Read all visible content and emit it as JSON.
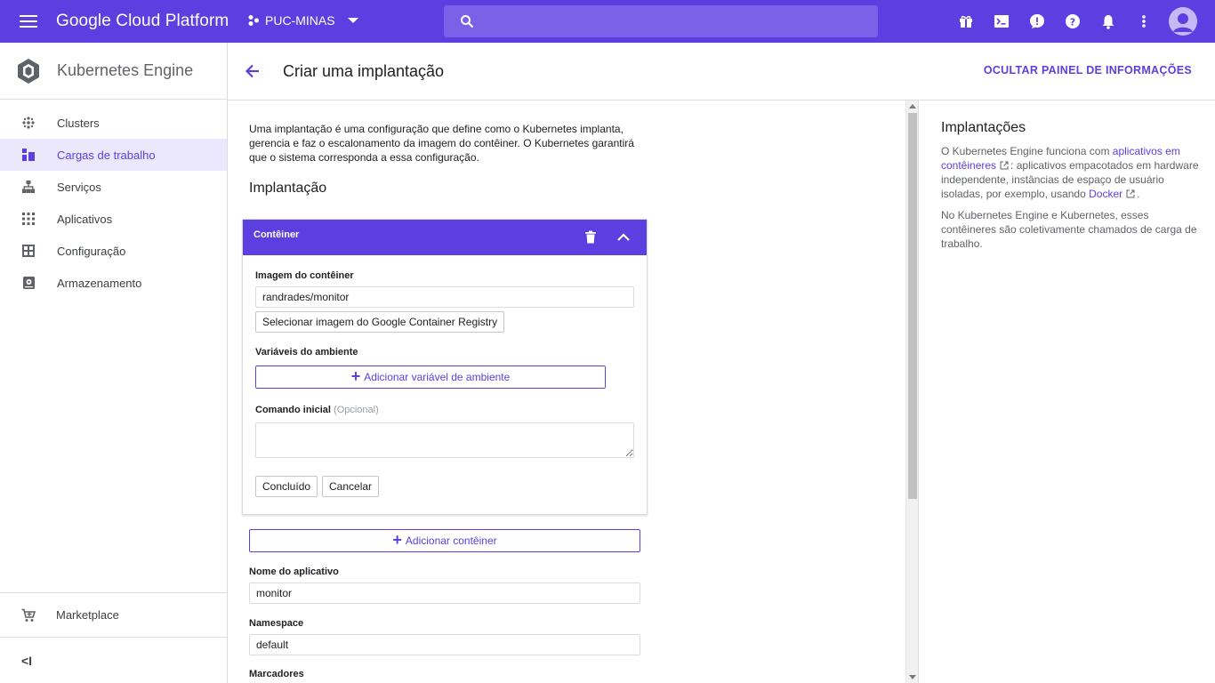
{
  "topbar": {
    "brand": "Google Cloud Platform",
    "project": "PUC-MINAS",
    "search_placeholder": "",
    "icons": [
      "gift-icon",
      "terminal-icon",
      "feedback-icon",
      "help-icon",
      "notifications-icon",
      "more-vert-icon"
    ]
  },
  "sidebar": {
    "product": "Kubernetes Engine",
    "items": [
      {
        "label": "Clusters",
        "icon": "clusters-icon"
      },
      {
        "label": "Cargas de trabalho",
        "icon": "workloads-icon",
        "active": true
      },
      {
        "label": "Serviços",
        "icon": "services-icon"
      },
      {
        "label": "Aplicativos",
        "icon": "apps-icon"
      },
      {
        "label": "Configuração",
        "icon": "config-icon"
      },
      {
        "label": "Armazenamento",
        "icon": "storage-icon"
      }
    ],
    "marketplace": "Marketplace",
    "collapse": "<I"
  },
  "header": {
    "title": "Criar uma implantação",
    "hide_panel": "OCULTAR PAINEL DE INFORMAÇÕES"
  },
  "main": {
    "description": "Uma implantação é uma configuração que define como o Kubernetes implanta, gerencia e faz o escalonamento da imagem do contêiner. O Kubernetes garantirá que o sistema corresponda a essa configuração.",
    "section_title": "Implantação",
    "container_card": {
      "title": "Contêiner",
      "image_label": "Imagem do contêiner",
      "image_value": "randrades/monitor",
      "select_image_button": "Selecionar imagem do Google Container Registry",
      "env_label": "Variáveis do ambiente",
      "add_env_button": "Adicionar variável de ambiente",
      "command_label": "Comando inicial",
      "command_optional": "(Opcional)",
      "command_value": "",
      "done_button": "Concluído",
      "cancel_button": "Cancelar"
    },
    "add_container_button": "Adicionar contêiner",
    "app_name_label": "Nome do aplicativo",
    "app_name_value": "monitor",
    "namespace_label": "Namespace",
    "namespace_value": "default",
    "labels_label": "Marcadores"
  },
  "info_panel": {
    "title": "Implantações",
    "p1_pre": "O Kubernetes Engine funciona com ",
    "p1_link1": "aplicativos em contêineres",
    "p1_mid": ": aplicativos empacotados em hardware independente, instâncias de espaço de usuário isoladas, por exemplo, usando ",
    "p1_link2": "Docker",
    "p1_end": ".",
    "p2": "No Kubernetes Engine e Kubernetes, esses contêineres são coletivamente chamados de carga de trabalho."
  },
  "colors": {
    "accent": "#5c3fe0",
    "active_bg": "#ebe7fc"
  }
}
